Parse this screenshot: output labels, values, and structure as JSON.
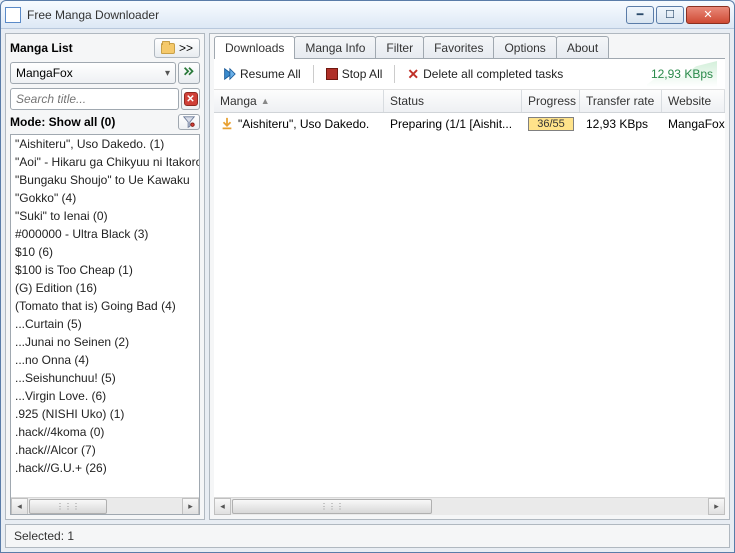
{
  "window": {
    "title": "Free Manga Downloader"
  },
  "sidebar": {
    "heading": "Manga List",
    "folder_more": ">>",
    "source": "MangaFox",
    "search_placeholder": "Search title...",
    "mode_label": "Mode:",
    "mode_value": "Show all (0)",
    "items": [
      "\"Aishiteru\", Uso Dakedo. (1)",
      "\"Aoi\" - Hikaru ga Chikyuu ni Itakoro",
      "\"Bungaku Shoujo\" to Ue Kawaku",
      "\"Gokko\" (4)",
      "\"Suki\" to Ienai (0)",
      "#000000 - Ultra Black (3)",
      "$10 (6)",
      "$100 is Too Cheap (1)",
      "(G) Edition (16)",
      "(Tomato that is) Going Bad (4)",
      "...Curtain (5)",
      "...Junai no Seinen (2)",
      "...no Onna (4)",
      "...Seishunchuu! (5)",
      "...Virgin Love. (6)",
      ".925 (NISHI Uko) (1)",
      ".hack//4koma (0)",
      ".hack//Alcor (7)",
      ".hack//G.U.+ (26)"
    ]
  },
  "tabs": [
    "Downloads",
    "Manga Info",
    "Filter",
    "Favorites",
    "Options",
    "About"
  ],
  "toolbar": {
    "resume": "Resume All",
    "stop": "Stop All",
    "delete": "Delete all completed tasks",
    "speed": "12,93 KBps"
  },
  "grid": {
    "columns": [
      "Manga",
      "Status",
      "Progress",
      "Transfer rate",
      "Website"
    ],
    "rows": [
      {
        "manga": "\"Aishiteru\", Uso Dakedo.",
        "status": "Preparing (1/1 [Aishit...",
        "progress": "36/55",
        "rate": "12,93 KBps",
        "website": "MangaFox"
      }
    ]
  },
  "statusbar": "Selected: 1"
}
